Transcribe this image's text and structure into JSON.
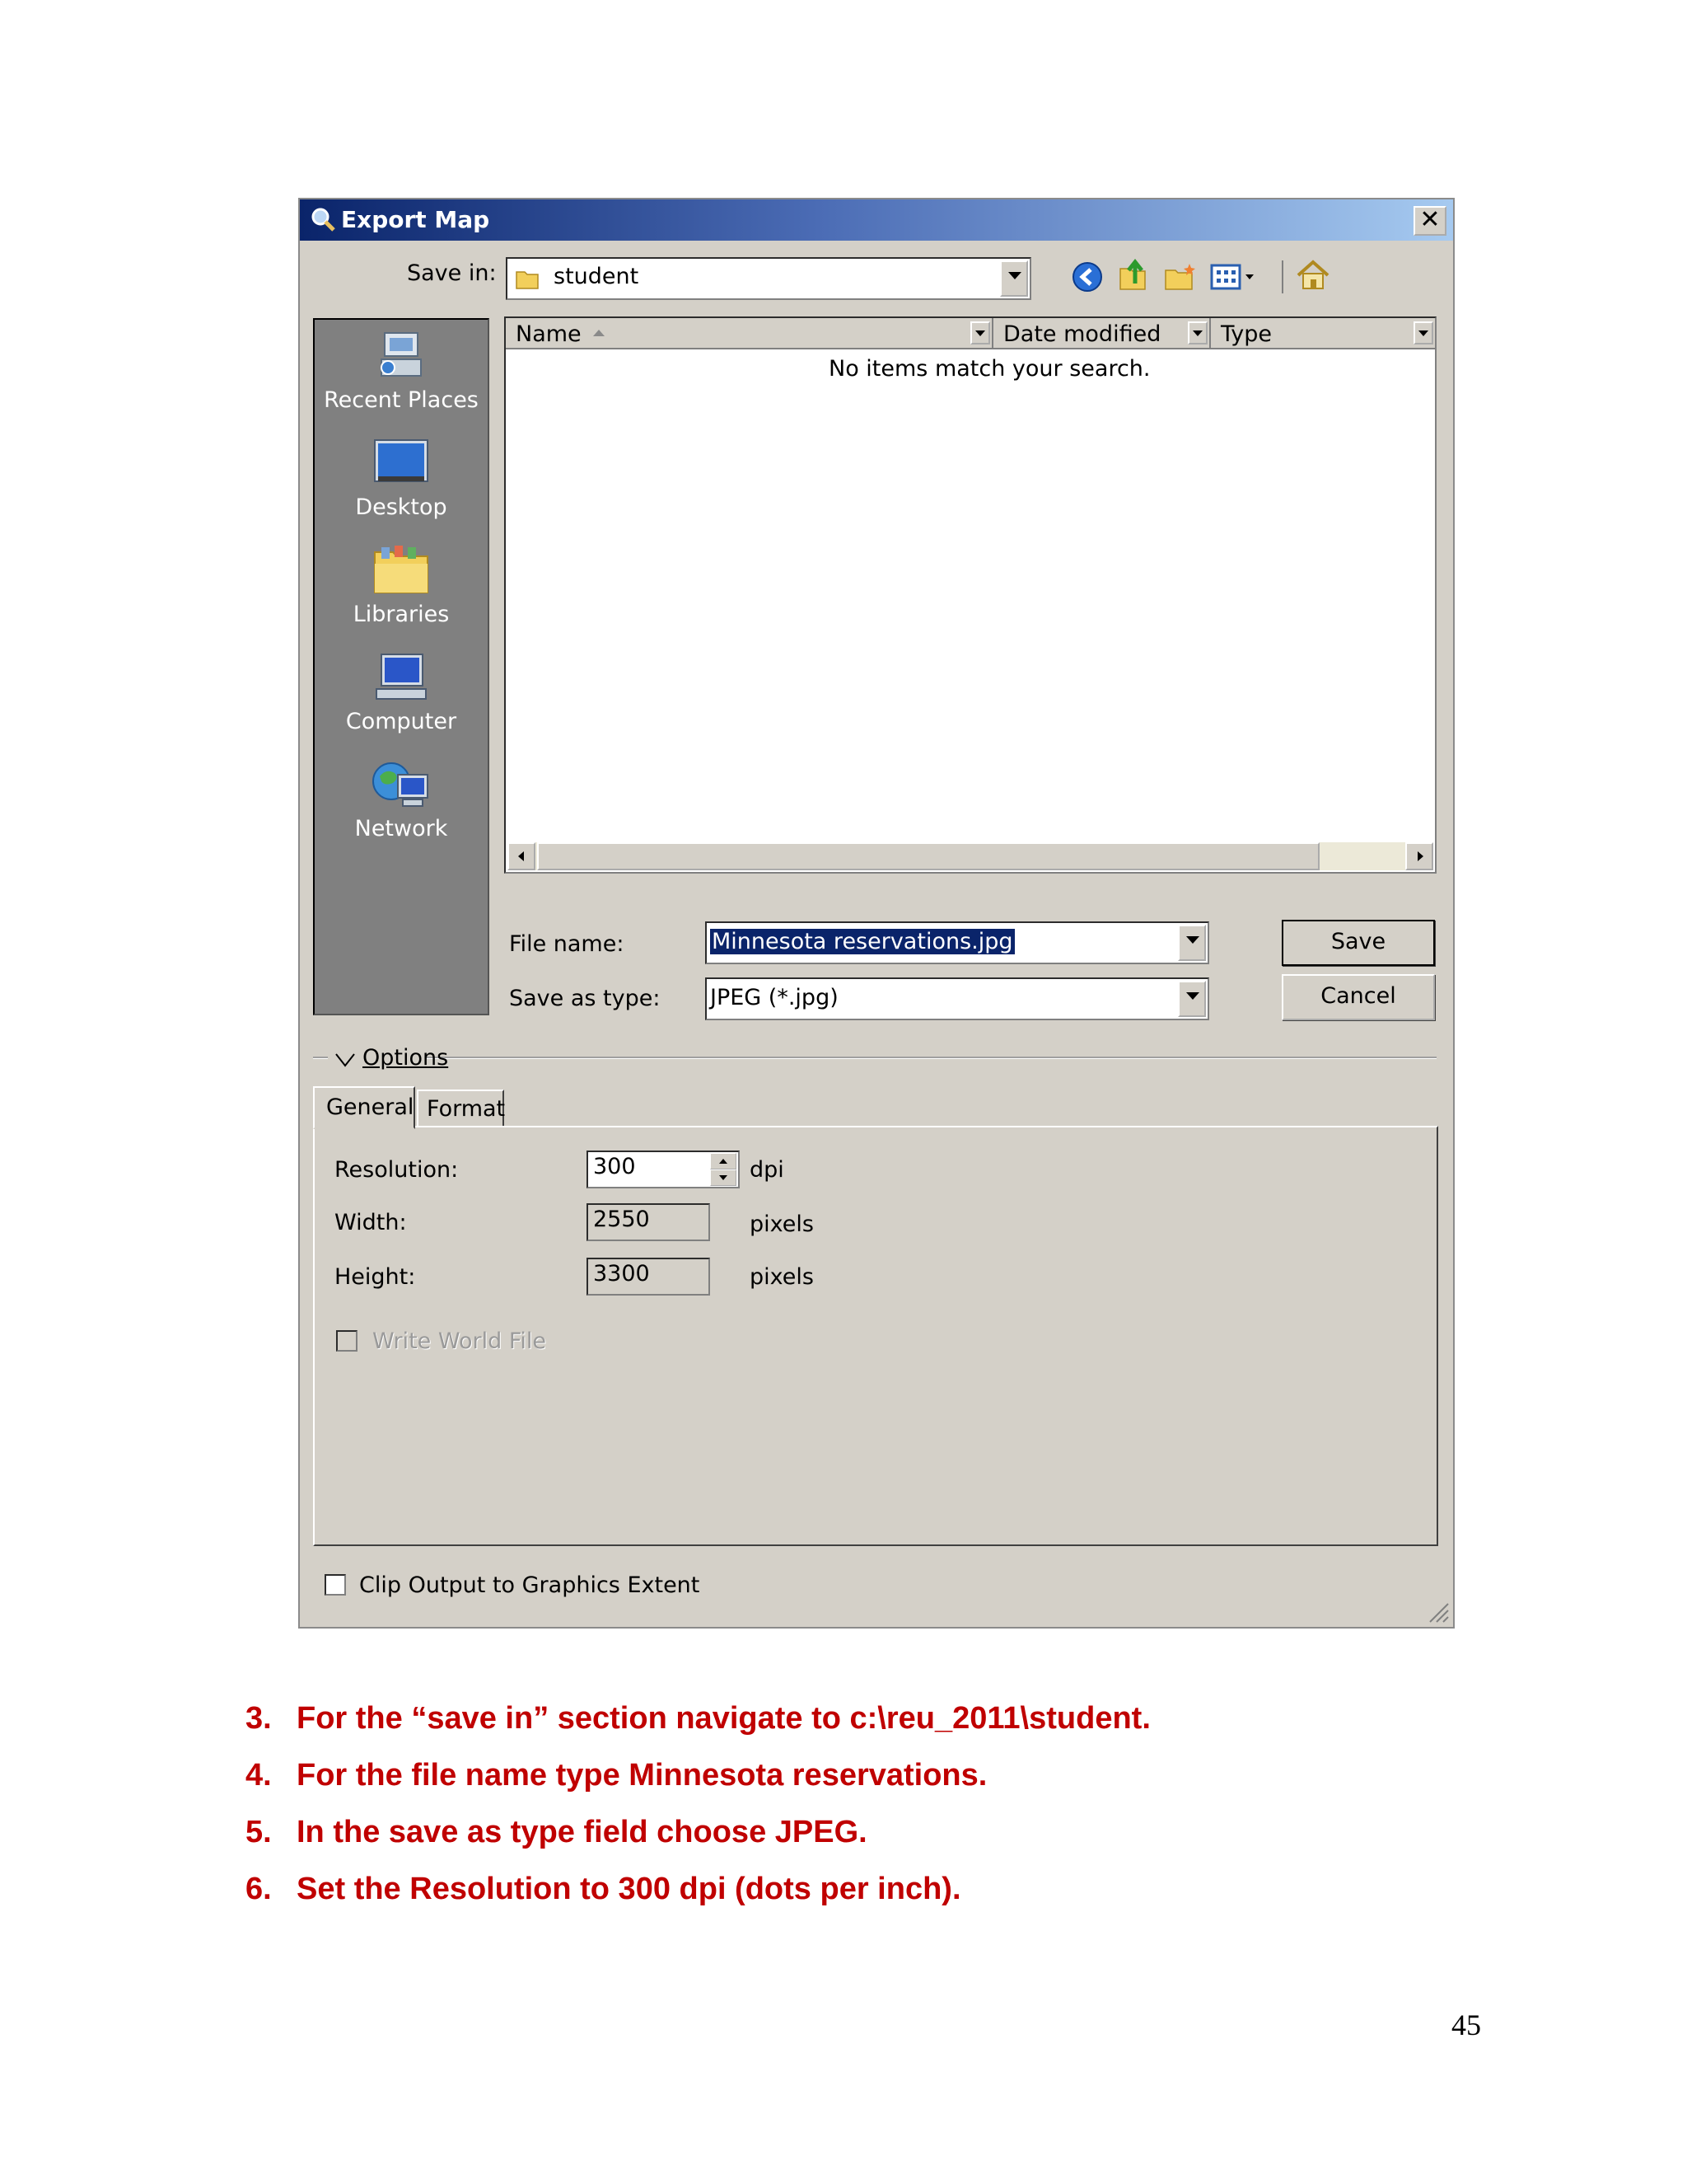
{
  "dialog": {
    "title": "Export Map",
    "close_label": "✕",
    "save_in_label": "Save in:",
    "save_in_value": "student",
    "places": [
      {
        "label": "Recent Places"
      },
      {
        "label": "Desktop"
      },
      {
        "label": "Libraries"
      },
      {
        "label": "Computer"
      },
      {
        "label": "Network"
      }
    ],
    "columns": [
      "Name",
      "Date modified",
      "Type"
    ],
    "empty_message": "No items match your search.",
    "file_name_label": "File name:",
    "file_name_value": "Minnesota reservations.jpg",
    "save_as_type_label": "Save as type:",
    "save_as_type_value": "JPEG (*.jpg)",
    "save_button": "Save",
    "cancel_button": "Cancel",
    "options_label": "Options",
    "tabs": [
      "General",
      "Format"
    ],
    "resolution_label": "Resolution:",
    "resolution_value": "300",
    "resolution_unit": "dpi",
    "width_label": "Width:",
    "width_value": "2550",
    "width_unit": "pixels",
    "height_label": "Height:",
    "height_value": "3300",
    "height_unit": "pixels",
    "write_world_file_label": "Write World File",
    "clip_output_label": "Clip Output to Graphics Extent"
  },
  "instructions": [
    {
      "num": "3.",
      "text": "For the “save in” section navigate to c:\\reu_2011\\student."
    },
    {
      "num": "4.",
      "text": "For the file name type Minnesota reservations."
    },
    {
      "num": "5.",
      "text": "In the save as type field choose JPEG."
    },
    {
      "num": "6.",
      "text": "Set the Resolution to 300 dpi (dots per inch)."
    }
  ],
  "page_number": "45"
}
